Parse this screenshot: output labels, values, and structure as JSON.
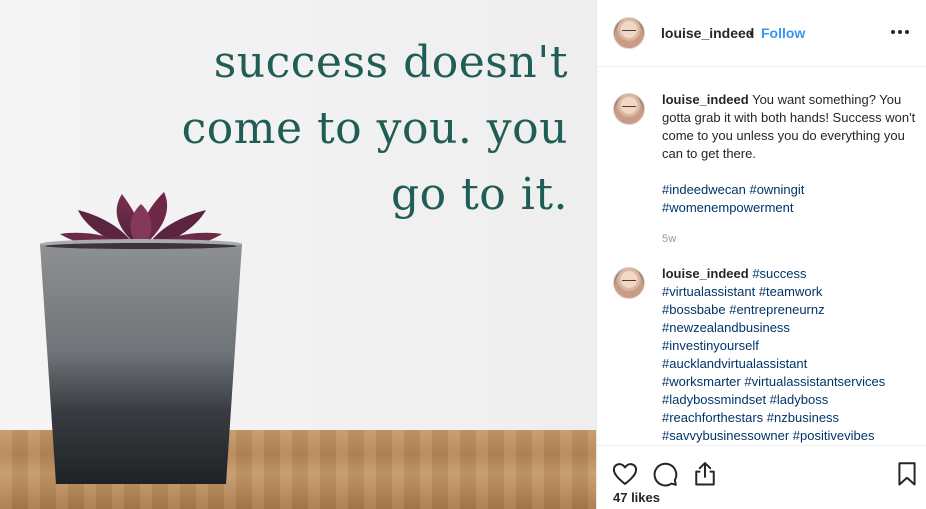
{
  "post": {
    "image": {
      "quote_lines": [
        "success doesn't",
        "come to you. you",
        "go to it."
      ],
      "alt": "Succulent plant in grey pot on wooden table"
    },
    "header": {
      "username": "louise_indeed",
      "separator": "•",
      "follow_label": "Follow",
      "more_icon": "ellipsis-icon"
    },
    "caption": {
      "username": "louise_indeed",
      "text": "You want something? You gotta grab it with both hands! Success won't come to you unless you do everything you can to get there.",
      "hashtags_line1": "#indeedwecan #owningit",
      "hashtags_line2": "#womenempowerment",
      "age": "5w"
    },
    "comment": {
      "username": "louise_indeed",
      "first_tag": "#success",
      "tag_lines": [
        "#virtualassistant #teamwork",
        "#bossbabe #entrepreneurnz",
        "#newzealandbusiness",
        "#investinyourself",
        "#aucklandvirtualassistant",
        "#worksmarter #virtualassistantservices",
        "#ladybossmindset #ladyboss",
        "#reachforthestars #nzbusiness",
        "#savvybusinessowner #positivevibes"
      ]
    },
    "actions": {
      "like_icon": "heart-icon",
      "comment_icon": "comment-icon",
      "share_icon": "share-icon",
      "save_icon": "bookmark-icon"
    },
    "likes_label": "47 likes"
  },
  "colors": {
    "link_blue": "#3897f0",
    "hashtag": "#003569",
    "quote_green": "#1f5d55"
  }
}
